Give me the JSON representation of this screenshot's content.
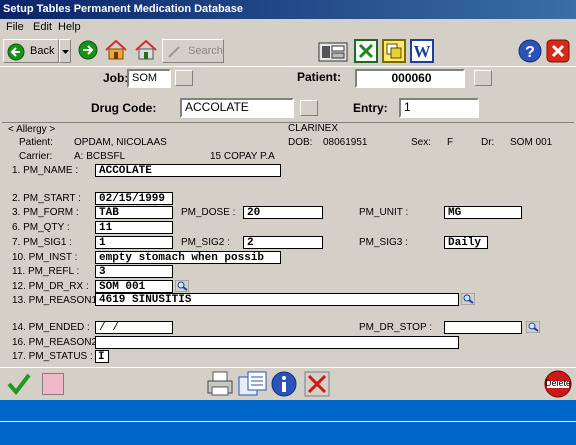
{
  "window": {
    "title": "Setup Tables Permanent Medication Database"
  },
  "menu": {
    "file": "File",
    "edit": "Edit",
    "help": "Help"
  },
  "toolbar": {
    "back": "Back",
    "search": "Search"
  },
  "header": {
    "job_label": "Job:",
    "job_value": "SOM",
    "patient_label": "Patient:",
    "patient_value": "000060",
    "drug_label": "Drug Code:",
    "drug_value": "ACCOLATE",
    "entry_label": "Entry:",
    "entry_value": "1"
  },
  "allergy": {
    "tab": "< Allergy >",
    "allergy_value": "CLARINEX",
    "patient_label": "Patient:",
    "patient_name": "OPDAM, NICOLAAS",
    "dob_label": "DOB:",
    "dob_value": "08061951",
    "sex_label": "Sex:",
    "sex_value": "F",
    "dr_label": "Dr:",
    "dr_value": "SOM 001",
    "carrier_label": "Carrier:",
    "carrier_value": "A: BCBSFL",
    "copay": "15 COPAY P.A"
  },
  "form": {
    "pm_name_label": "1. PM_NAME :",
    "pm_name": "ACCOLATE",
    "pm_start_label": "2. PM_START :",
    "pm_start": "02/15/1999",
    "pm_form_label": "3. PM_FORM :",
    "pm_form": "TAB",
    "pm_dose_label": "PM_DOSE :",
    "pm_dose": "20",
    "pm_unit_label": "PM_UNIT :",
    "pm_unit": "MG",
    "pm_qty_label": "6. PM_QTY :",
    "pm_qty": "11",
    "pm_sig1_label": "7. PM_SIG1 :",
    "pm_sig1": "1",
    "pm_sig2_label": "PM_SIG2 :",
    "pm_sig2": "2",
    "pm_sig3_label": "PM_SIG3 :",
    "pm_sig3": "Daily",
    "pm_inst_label": "10. PM_INST :",
    "pm_inst": "empty stomach when possib",
    "pm_refl_label": "11. PM_REFL :",
    "pm_refl": "3",
    "pm_dr_rx_label": "12. PM_DR_RX :",
    "pm_dr_rx": "SOM  001",
    "pm_reason1_label": "13. PM_REASON1",
    "pm_reason1": "4619 SINUSITIS",
    "pm_ended_label": "14. PM_ENDED :",
    "pm_ended": "  /  /",
    "pm_dr_stop_label": "PM_DR_STOP :",
    "pm_dr_stop": "",
    "pm_reason2_label": "16. PM_REASON2",
    "pm_reason2": "",
    "pm_status_label": "17. PM_STATUS :",
    "pm_status": "I"
  },
  "bottom": {
    "delete_label": "Delete"
  },
  "colors": {
    "title_bar": "#0a246a",
    "face": "#d4d0c8",
    "footer_blue": "#0066cc"
  }
}
